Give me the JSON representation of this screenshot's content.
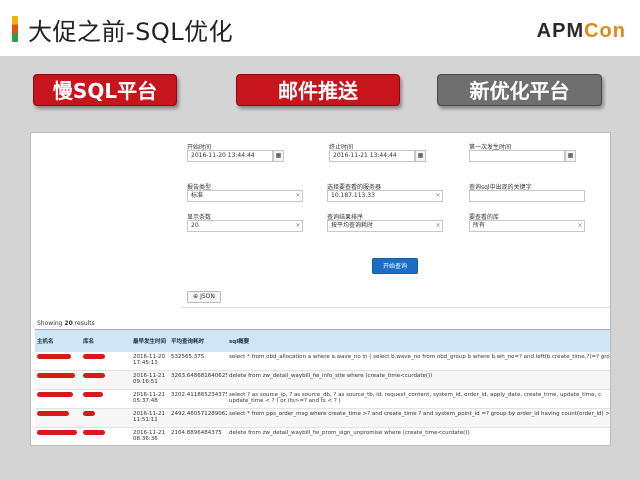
{
  "header": {
    "title": "大促之前-SQL优化",
    "brand_main": "APM",
    "brand_accent": "Con"
  },
  "pills": [
    {
      "label": "慢SQL平台",
      "style": "red"
    },
    {
      "label": "邮件推送",
      "style": "red"
    },
    {
      "label": "新优化平台",
      "style": "gray"
    }
  ],
  "form": {
    "start_time_label": "开始时间",
    "start_time_value": "2016-11-20 13:44:44",
    "end_time_label": "终止时间",
    "end_time_value": "2016-11-21 13:44:44",
    "first_time_label": "第一次发生时间",
    "first_time_value": "",
    "report_type_label": "报告类型",
    "report_type_value": "标准",
    "server_label": "选择要查看的服务器",
    "server_value": "10.187.113.33",
    "keyword_label": "查询sql中出现的关键字",
    "keyword_value": "",
    "count_label": "显示条数",
    "count_value": "20",
    "sort_label": "查询结果排序",
    "sort_value": "按平均查询耗时",
    "db_label": "要查看的库",
    "db_value": "所有",
    "query_button": "开始查询",
    "json_button": "JSON"
  },
  "results": {
    "showing_prefix": "Showing",
    "showing_count": "20",
    "showing_suffix": "results",
    "columns": [
      "主机名",
      "库名",
      "最早发生时间",
      "平均查询耗时",
      "sql概要"
    ],
    "rows": [
      {
        "time": "2016-11-20 17:45:13",
        "avg": "532565.375",
        "sql": "select * from obd_allocation a where a.wave_no in ( select b.wave_no from obd_group b where b.wh_no=? and left(b.create_time,?)=? group b"
      },
      {
        "time": "2016-11-21 09:16:51",
        "avg": "3263.648681640625",
        "sql": "delete from zw_detail_waybill_fw_info_site where (create_time<curdate())"
      },
      {
        "time": "2016-11-21 05:37:48",
        "avg": "3202.411865234375",
        "sql": "select ? as source_ip, ? as source_db, ? as source_tb, id, request_content, system_id, order_id, apply_date, create_time, update_time, c"
      },
      {
        "time": "2016-11-21 11:51:11",
        "avg": "2492.4605712890625",
        "sql": "select * from pps_order_msg where create_time >? and create_time ? and system_point_id =? group by order_id having count(order_id) >"
      },
      {
        "time": "2016-11-21 08:36:36",
        "avg": "2164.8896484375",
        "sql": "delete from zw_detail_waybill_fw_prom_sign_unpromise where (create_time<curdate())"
      }
    ],
    "row3_continuation": "update_time < ? ) or (ts>=? and ts < ? )"
  },
  "colors": {
    "pill_red": "#c8141c",
    "pill_gray": "#6f6f6f",
    "query_blue": "#1a6fc4",
    "table_header": "#cfe6f5",
    "brand_accent": "#e0891a"
  }
}
